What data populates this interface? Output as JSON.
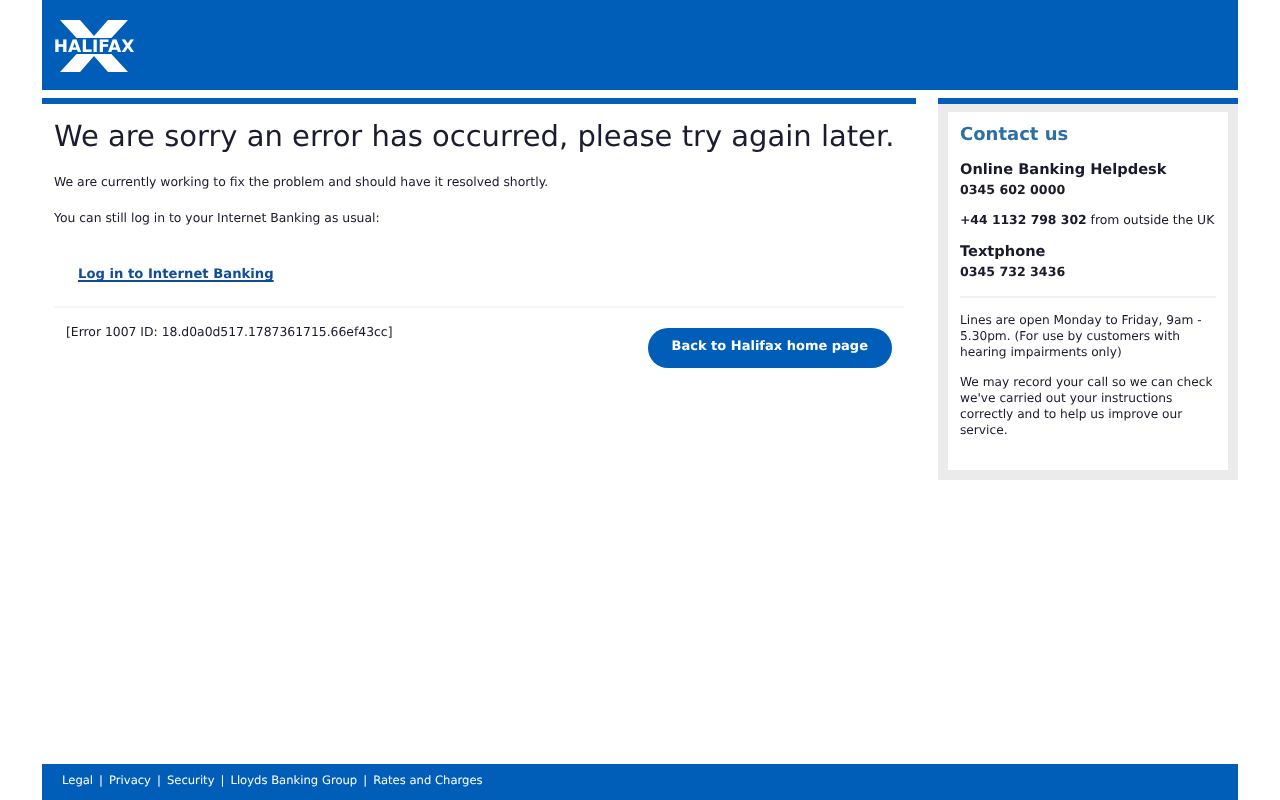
{
  "header": {
    "logo": "HALIFAX"
  },
  "main": {
    "title": "We are sorry an error has occurred, please try again later.",
    "paragraphs": [
      "We are currently working to fix the problem and should have it resolved shortly.",
      "You can still log in to your Internet Banking as usual:"
    ],
    "login_link": "Log in to Internet Banking",
    "error_ref": "[Error 1007 ID: 18.d0a0d517.1787361715.66ef43cc]",
    "home_button": "Back to Halifax home page"
  },
  "contact": {
    "title": "Contact us",
    "helpdesk_title": "Online Banking Helpdesk",
    "helpdesk_phone": "0345 602 0000",
    "overseas": "**+44 1132 798 302** from outside the UK",
    "textphone_title": "Textphone",
    "textphone_phone": "0345 732 3436",
    "notes": [
      "Lines are open Monday to Friday, 9am - 5.30pm. (For use by customers with hearing impairments only)",
      "We may record your call so we can check we've carried out your instructions correctly and to help us improve our service."
    ]
  },
  "footer": {
    "separator": "|",
    "links": [
      "Legal",
      "Privacy",
      "Security",
      "Lloyds Banking Group",
      "Rates and Charges"
    ]
  }
}
